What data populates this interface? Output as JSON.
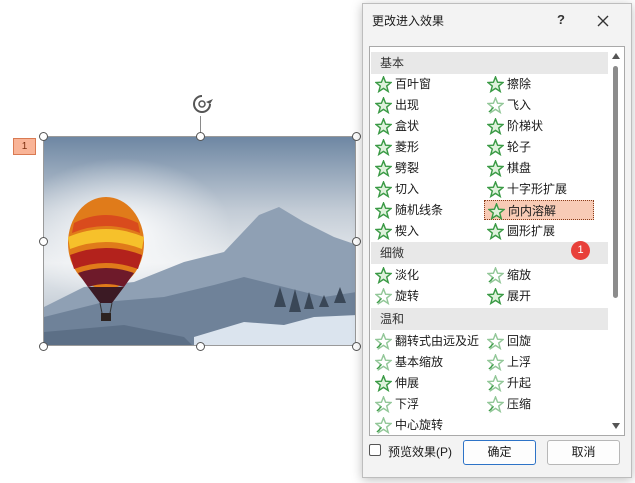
{
  "slide": {
    "animation_tag": "1"
  },
  "dialog": {
    "title": "更改进入效果",
    "help_label": "?",
    "groups": [
      {
        "name": "基本"
      },
      {
        "name": "细微"
      },
      {
        "name": "温和"
      }
    ],
    "basic_effects": [
      "百叶窗",
      "擦除",
      "出现",
      "飞入",
      "盒状",
      "阶梯状",
      "菱形",
      "轮子",
      "劈裂",
      "棋盘",
      "切入",
      "十字形扩展",
      "随机线条",
      "向内溶解",
      "楔入",
      "圆形扩展"
    ],
    "subtle_effects": [
      "淡化",
      "缩放",
      "旋转",
      "展开"
    ],
    "moderate_effects": [
      "翻转式由远及近",
      "回旋",
      "基本缩放",
      "上浮",
      "伸展",
      "升起",
      "下浮",
      "压缩",
      "中心旋转"
    ],
    "selected_effect": "向内溶解",
    "selected_badge": "1",
    "preview_label": "预览效果(P)",
    "preview_checked": false,
    "ok_label": "确定",
    "cancel_label": "取消"
  },
  "colors": {
    "star_green": "#3a9a45",
    "selected_bg": "#f8cbb6",
    "badge_red": "#e8403a",
    "ok_border": "#2d73c7"
  }
}
